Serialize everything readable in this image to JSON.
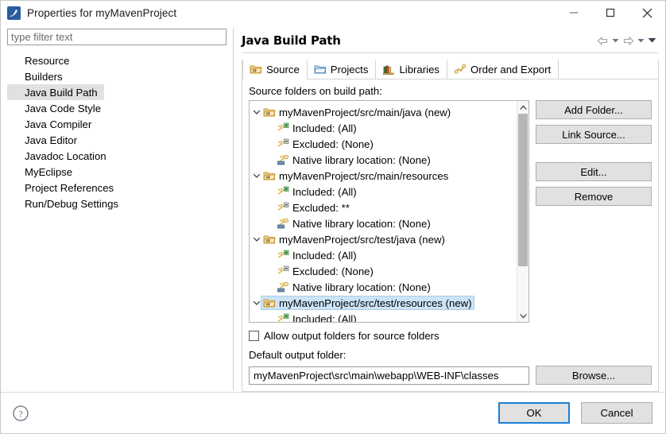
{
  "window": {
    "title": "Properties for myMavenProject",
    "app_icon": "eclipse-icon",
    "minimize_label": "Minimize",
    "maximize_label": "Maximize",
    "close_label": "Close"
  },
  "sidebar": {
    "filter_placeholder": "type filter text",
    "filter_value": "",
    "items": [
      {
        "label": "Resource",
        "selected": false
      },
      {
        "label": "Builders",
        "selected": false
      },
      {
        "label": "Java Build Path",
        "selected": true
      },
      {
        "label": "Java Code Style",
        "selected": false
      },
      {
        "label": "Java Compiler",
        "selected": false
      },
      {
        "label": "Java Editor",
        "selected": false
      },
      {
        "label": "Javadoc Location",
        "selected": false
      },
      {
        "label": "MyEclipse",
        "selected": false
      },
      {
        "label": "Project References",
        "selected": false
      },
      {
        "label": "Run/Debug Settings",
        "selected": false
      }
    ]
  },
  "header": {
    "title": "Java Build Path",
    "back_icon": "arrow-left-icon",
    "back_caret_icon": "chevron-down-icon",
    "forward_icon": "arrow-right-icon",
    "forward_caret_icon": "chevron-down-icon",
    "menu_caret_icon": "chevron-down-icon"
  },
  "tabs": [
    {
      "label": "Source",
      "icon": "source-folder-icon",
      "active": true
    },
    {
      "label": "Projects",
      "icon": "projects-folder-icon",
      "active": false
    },
    {
      "label": "Libraries",
      "icon": "libraries-books-icon",
      "active": false
    },
    {
      "label": "Order and Export",
      "icon": "order-export-icon",
      "active": false
    }
  ],
  "main": {
    "source_folders_label": "Source folders on build path:",
    "tree": [
      {
        "level": 0,
        "icon": "source-folder-icon",
        "twisty": "expanded",
        "text": "myMavenProject/src/main/java (new)",
        "selected": false
      },
      {
        "level": 1,
        "icon": "included-icon",
        "twisty": "none",
        "text": "Included: (All)",
        "selected": false
      },
      {
        "level": 1,
        "icon": "excluded-icon",
        "twisty": "none",
        "text": "Excluded: (None)",
        "selected": false
      },
      {
        "level": 1,
        "icon": "native-library-icon",
        "twisty": "none",
        "text": "Native library location: (None)",
        "selected": false
      },
      {
        "level": 0,
        "icon": "source-folder-icon",
        "twisty": "expanded",
        "text": "myMavenProject/src/main/resources",
        "selected": false
      },
      {
        "level": 1,
        "icon": "included-icon",
        "twisty": "none",
        "text": "Included: (All)",
        "selected": false
      },
      {
        "level": 1,
        "icon": "excluded-icon",
        "twisty": "none",
        "text": "Excluded: **",
        "selected": false
      },
      {
        "level": 1,
        "icon": "native-library-icon",
        "twisty": "none",
        "text": "Native library location: (None)",
        "selected": false
      },
      {
        "level": 0,
        "icon": "source-folder-icon",
        "twisty": "expanded",
        "text": "myMavenProject/src/test/java (new)",
        "selected": false
      },
      {
        "level": 1,
        "icon": "included-icon",
        "twisty": "none",
        "text": "Included: (All)",
        "selected": false
      },
      {
        "level": 1,
        "icon": "excluded-icon",
        "twisty": "none",
        "text": "Excluded: (None)",
        "selected": false
      },
      {
        "level": 1,
        "icon": "native-library-icon",
        "twisty": "none",
        "text": "Native library location: (None)",
        "selected": false
      },
      {
        "level": 0,
        "icon": "source-folder-icon",
        "twisty": "expanded",
        "text": "myMavenProject/src/test/resources (new)",
        "selected": true
      },
      {
        "level": 1,
        "icon": "included-icon",
        "twisty": "none",
        "text": "Included: (All)",
        "selected": false
      }
    ],
    "scrollbar": {
      "up_icon": "chevron-up-icon",
      "down_icon": "chevron-down-icon",
      "thumb_percent": 78
    },
    "side_buttons": [
      {
        "label": "Add Folder...",
        "gap_above": false
      },
      {
        "label": "Link Source...",
        "gap_above": false
      },
      {
        "label": "Edit...",
        "gap_above": true
      },
      {
        "label": "Remove",
        "gap_above": false
      }
    ],
    "allow_output_checkbox": {
      "label": "Allow output folders for source folders",
      "checked": false
    },
    "default_output_label": "Default output folder:",
    "default_output_value": "myMavenProject\\src\\main\\webapp\\WEB-INF\\classes",
    "browse_label": "Browse..."
  },
  "footer": {
    "help_icon": "help-question-icon",
    "ok_label": "OK",
    "cancel_label": "Cancel"
  },
  "colors": {
    "selection_blue": "#cce4f7",
    "sidebar_selection": "#e1e1e1",
    "default_button_border": "#1a7fd4",
    "folder_gold": "#e8c170"
  }
}
